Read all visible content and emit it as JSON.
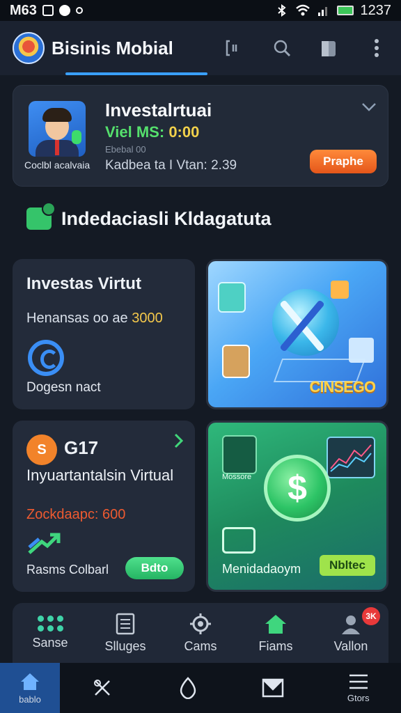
{
  "status_bar": {
    "left_text": "M63",
    "right_text": "1237"
  },
  "app": {
    "title": "Bisinis Mobial"
  },
  "top_card": {
    "avatar_caption": "Coclbl acalvaia",
    "title": "Investalrtuai",
    "green_label": "Viel MS:",
    "green_value": "0:00",
    "small_text": "Ebebal 00",
    "info_line": "Kadbea ta I Vtan: 2.39",
    "button_label": "Praphe"
  },
  "section": {
    "title": "Indedaciasli Kldagatuta"
  },
  "tiles": {
    "t1": {
      "title": "Investas Virtut",
      "sub_label": "Henansas oo ae",
      "sub_value": "3000",
      "footer": "Dogesn nact"
    },
    "t2": {
      "label": "CINSEGO"
    },
    "t3": {
      "badge": "S",
      "number": "G17",
      "title": "Inyuartantalsin Virtual",
      "red_text": "Zockdaapc: 600",
      "footer": "Rasms Colbarl",
      "button_label": "Bdto"
    },
    "t4": {
      "shield_label": "Mossore",
      "footer": "Menidadaoym",
      "pill_label": "Nbltec"
    }
  },
  "sub_nav": [
    {
      "label": "Sanse",
      "icon": "dots-grid-icon"
    },
    {
      "label": "Slluges",
      "icon": "document-icon"
    },
    {
      "label": "Cams",
      "icon": "gear-icon"
    },
    {
      "label": "Fiams",
      "icon": "home-icon"
    },
    {
      "label": "Vallon",
      "icon": "user-icon",
      "badge": "3K"
    }
  ],
  "bottom_nav": [
    {
      "label": "bablo",
      "icon": "home-icon",
      "active": true
    },
    {
      "label": "",
      "icon": "tools-icon"
    },
    {
      "label": "",
      "icon": "drop-icon"
    },
    {
      "label": "",
      "icon": "mail-icon"
    },
    {
      "label": "Gtors",
      "icon": "menu-icon"
    }
  ],
  "colors": {
    "accent": "#3aa0ff",
    "green": "#55e06d",
    "orange": "#f2832a",
    "background": "#141a24"
  }
}
